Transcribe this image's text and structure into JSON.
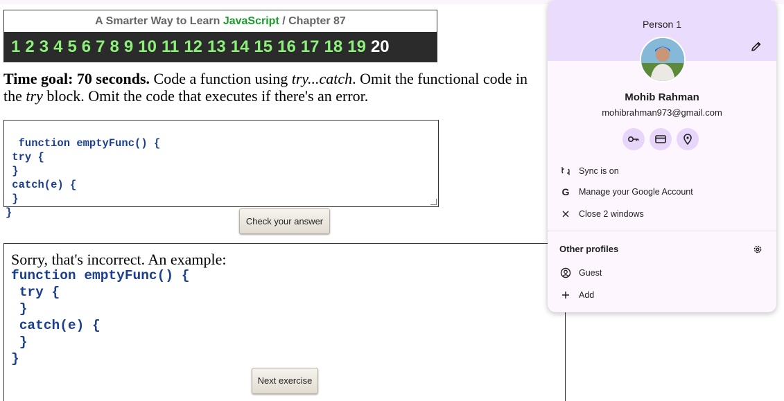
{
  "header": {
    "title_prefix": "A Smarter Way to Learn",
    "title_js": "JavaScript",
    "title_sep": "/",
    "title_chapter": "Chapter 87",
    "chapter_numbers": [
      "1",
      "2",
      "3",
      "4",
      "5",
      "6",
      "7",
      "8",
      "9",
      "10",
      "11",
      "12",
      "13",
      "14",
      "15",
      "16",
      "17",
      "18",
      "19",
      "20"
    ],
    "current_chapter": "20"
  },
  "instructions": {
    "bold": "Time goal: 70 seconds.",
    "text1": " Code a function using ",
    "italic1": "try...catch",
    "text2": ". Omit the functional code in the ",
    "italic2": "try",
    "text3": " block. Omit the code that executes if there's an error."
  },
  "editor": {
    "code": "function emptyFunc() {\n try {\n }\n catch(e) {\n }\n}"
  },
  "buttons": {
    "check": "Check your answer",
    "next": "Next exercise"
  },
  "answer": {
    "message": "Sorry, that's incorrect. An example:",
    "code": "function emptyFunc() {\n try {\n }\n catch(e) {\n }\n}"
  },
  "profile": {
    "person_label": "Person 1",
    "name": "Mohib Rahman",
    "email": "mohibrahman973@gmail.com",
    "menu": {
      "sync": "Sync is on",
      "manage": "Manage your Google Account",
      "close": "Close 2 windows"
    },
    "other_profiles_title": "Other profiles",
    "guest": "Guest",
    "add": "Add",
    "accent_color": "#eadcfc"
  }
}
